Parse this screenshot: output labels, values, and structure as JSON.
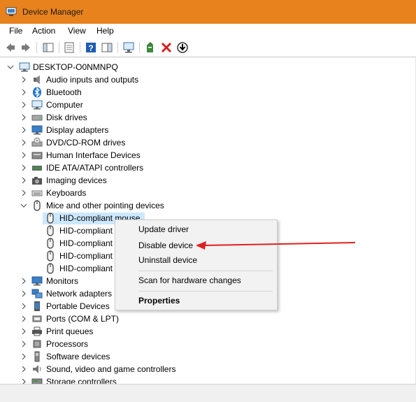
{
  "window": {
    "title": "Device Manager"
  },
  "menu": [
    "File",
    "Action",
    "View",
    "Help"
  ],
  "toolbar": {
    "icons": [
      "back-arrow-icon",
      "forward-arrow-icon",
      "show-hide-tree-icon",
      "properties-icon",
      "help-icon",
      "action-pane-icon",
      "scan-monitor-icon",
      "update-driver-icon",
      "uninstall-x-icon",
      "download-icon"
    ],
    "uninstall_color": "#d62020"
  },
  "tree": {
    "root": "DESKTOP-O0NMNPQ",
    "categories": [
      "Audio inputs and outputs",
      "Bluetooth",
      "Computer",
      "Disk drives",
      "Display adapters",
      "DVD/CD-ROM drives",
      "Human Interface Devices",
      "IDE ATA/ATAPI controllers",
      "Imaging devices",
      "Keyboards",
      "Mice and other pointing devices"
    ],
    "mice_children": [
      "HID-compliant mouse",
      "HID-compliant",
      "HID-compliant",
      "HID-compliant",
      "HID-compliant"
    ],
    "categories_after": [
      "Monitors",
      "Network adapters",
      "Portable Devices",
      "Ports (COM & LPT)",
      "Print queues",
      "Processors",
      "Software devices",
      "Sound, video and game controllers",
      "Storage controllers"
    ]
  },
  "context_menu": {
    "items": [
      "Update driver",
      "Disable device",
      "Uninstall device"
    ],
    "scan": "Scan for hardware changes",
    "properties": "Properties"
  },
  "annotation": {
    "arrow_color": "#e02020"
  },
  "colors": {
    "titlebar": "#e8821d",
    "selection": "#cce8ff",
    "accent_blue": "#1e73c8"
  }
}
